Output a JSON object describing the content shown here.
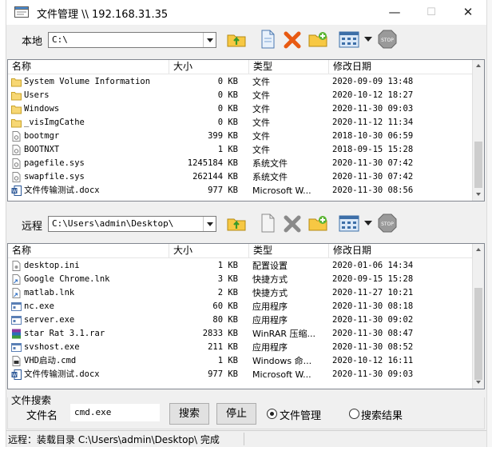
{
  "window": {
    "title": "文件管理 \\\\ 192.168.31.35",
    "minimize": "—",
    "maximize": "☐",
    "close": "✕"
  },
  "local": {
    "label": "本地",
    "path": "C:\\",
    "columns": [
      "名称",
      "大小",
      "类型",
      "修改日期"
    ],
    "rows": [
      {
        "icon": "folder-icon",
        "name": "System Volume Information",
        "size": "0 KB",
        "type": "文件",
        "date": "2020-09-09 13:48"
      },
      {
        "icon": "folder-icon",
        "name": "Users",
        "size": "0 KB",
        "type": "文件",
        "date": "2020-10-12 18:27"
      },
      {
        "icon": "folder-icon",
        "name": "Windows",
        "size": "0 KB",
        "type": "文件",
        "date": "2020-11-30 09:03"
      },
      {
        "icon": "folder-icon",
        "name": "_visImgCathe",
        "size": "0 KB",
        "type": "文件",
        "date": "2020-11-12 11:34"
      },
      {
        "icon": "system-file-icon",
        "name": "bootmgr",
        "size": "399 KB",
        "type": "文件",
        "date": "2018-10-30 06:59"
      },
      {
        "icon": "system-file-icon",
        "name": "BOOTNXT",
        "size": "1 KB",
        "type": "文件",
        "date": "2018-09-15 15:28"
      },
      {
        "icon": "system-file-icon",
        "name": "pagefile.sys",
        "size": "1245184 KB",
        "type": "系统文件",
        "date": "2020-11-30 07:42"
      },
      {
        "icon": "system-file-icon",
        "name": "swapfile.sys",
        "size": "262144 KB",
        "type": "系统文件",
        "date": "2020-11-30 07:42"
      },
      {
        "icon": "word-doc-icon",
        "name": "文件传输测试.docx",
        "size": "977 KB",
        "type": "Microsoft W...",
        "date": "2020-11-30 08:56"
      }
    ]
  },
  "remote": {
    "label": "远程",
    "path": "C:\\Users\\admin\\Desktop\\",
    "columns": [
      "名称",
      "大小",
      "类型",
      "修改日期"
    ],
    "rows": [
      {
        "icon": "settings-file-icon",
        "name": "desktop.ini",
        "size": "1 KB",
        "type": "配置设置",
        "date": "2020-01-06 14:34"
      },
      {
        "icon": "shortcut-file-icon",
        "name": "Google Chrome.lnk",
        "size": "3 KB",
        "type": "快捷方式",
        "date": "2020-09-15 15:28"
      },
      {
        "icon": "shortcut-file-icon",
        "name": "matlab.lnk",
        "size": "2 KB",
        "type": "快捷方式",
        "date": "2020-11-27 10:21"
      },
      {
        "icon": "exe-file-icon",
        "name": "nc.exe",
        "size": "60 KB",
        "type": "应用程序",
        "date": "2020-11-30 08:18"
      },
      {
        "icon": "exe-file-icon",
        "name": "server.exe",
        "size": "80 KB",
        "type": "应用程序",
        "date": "2020-11-30 09:02"
      },
      {
        "icon": "rar-archive-icon",
        "name": "star Rat 3.1.rar",
        "size": "2833 KB",
        "type": "WinRAR 压缩...",
        "date": "2020-11-30 08:47"
      },
      {
        "icon": "exe-file-icon",
        "name": "svshost.exe",
        "size": "211 KB",
        "type": "应用程序",
        "date": "2020-11-30 08:52"
      },
      {
        "icon": "cmd-file-icon",
        "name": "VHD启动.cmd",
        "size": "1 KB",
        "type": "Windows 命...",
        "date": "2020-10-12 16:11"
      },
      {
        "icon": "word-doc-icon",
        "name": "文件传输测试.docx",
        "size": "977 KB",
        "type": "Microsoft W...",
        "date": "2020-11-30 09:03"
      }
    ]
  },
  "search": {
    "group_label": "文件搜索",
    "filename_label": "文件名",
    "filename_value": "cmd.exe",
    "search_button": "搜索",
    "stop_button": "停止",
    "radio_file_manager": "文件管理",
    "radio_search_results": "搜索结果",
    "selected": "文件管理"
  },
  "status": {
    "text": "远程：装载目录 C:\\Users\\admin\\Desktop\\ 完成"
  },
  "colors": {
    "folder": "#f7d774",
    "delete_red": "#e53b1b",
    "add_green": "#5bb534",
    "stop_gray": "#8a8a8a"
  }
}
